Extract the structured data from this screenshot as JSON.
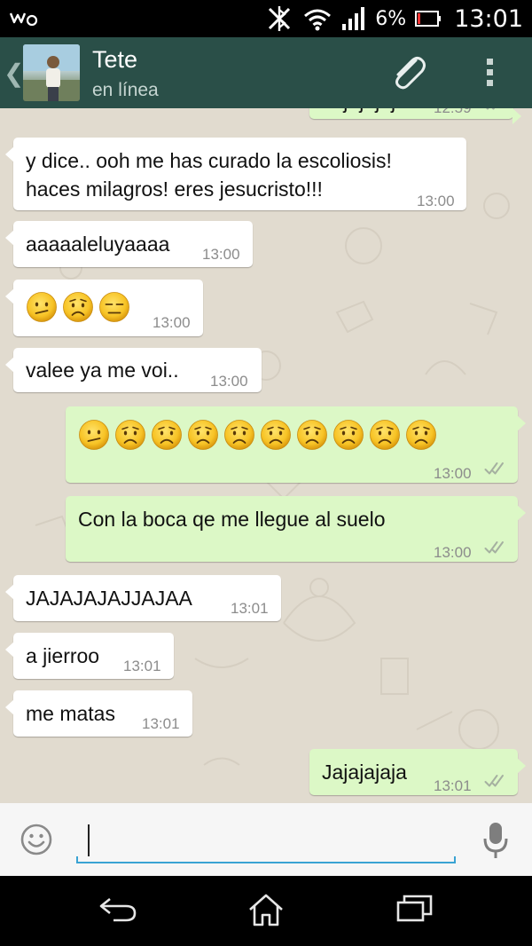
{
  "status_bar": {
    "battery_percent": "6%",
    "clock": "13:01",
    "icons": [
      "walkman-icon",
      "nfc-icon",
      "wifi-icon",
      "signal-icon",
      "battery-icon"
    ]
  },
  "header": {
    "contact_name": "Tete",
    "contact_status": "en línea",
    "icons": [
      "back-chevron-icon",
      "avatar",
      "paperclip-icon",
      "overflow-menu-icon"
    ],
    "color": "#2a4f48"
  },
  "messages": [
    {
      "direction": "out",
      "text": "Jajajajaj",
      "time": "12:59",
      "partial": true
    },
    {
      "direction": "in",
      "lines": [
        "y dice.. ooh me has curado la escoliosis!",
        "haces milagros! eres jesucristo!!!"
      ],
      "time": "13:00"
    },
    {
      "direction": "in",
      "text": "aaaaaleluyaaaa",
      "time": "13:00"
    },
    {
      "direction": "in",
      "emojis": [
        "confused",
        "worried",
        "expressionless"
      ],
      "time": "13:00"
    },
    {
      "direction": "in",
      "text": "valee ya me voi..",
      "time": "13:00"
    },
    {
      "direction": "out",
      "emojis": [
        "confused",
        "worried",
        "worried",
        "worried",
        "worried",
        "worried",
        "worried",
        "worried",
        "worried",
        "worried"
      ],
      "time": "13:00",
      "status": "read"
    },
    {
      "direction": "out",
      "text": "Con la boca qe me llegue al suelo",
      "time": "13:00",
      "status": "read"
    },
    {
      "direction": "in",
      "text": "JAJAJAJAJJAJAA",
      "time": "13:01"
    },
    {
      "direction": "in",
      "text": "a jierroo",
      "time": "13:01"
    },
    {
      "direction": "in",
      "text": "me matas",
      "time": "13:01"
    },
    {
      "direction": "out",
      "text": "Jajajajaja",
      "time": "13:01",
      "status": "read"
    }
  ],
  "input_bar": {
    "value": "",
    "icons": [
      "emoji-icon",
      "microphone-icon"
    ]
  },
  "nav_bar": {
    "icons": [
      "back-icon",
      "home-icon",
      "recents-icon"
    ]
  },
  "colors": {
    "incoming_bubble": "#ffffff",
    "outgoing_bubble": "#dcf8c6",
    "chat_background": "#e1dbcf",
    "input_accent": "#3aa3d3"
  }
}
